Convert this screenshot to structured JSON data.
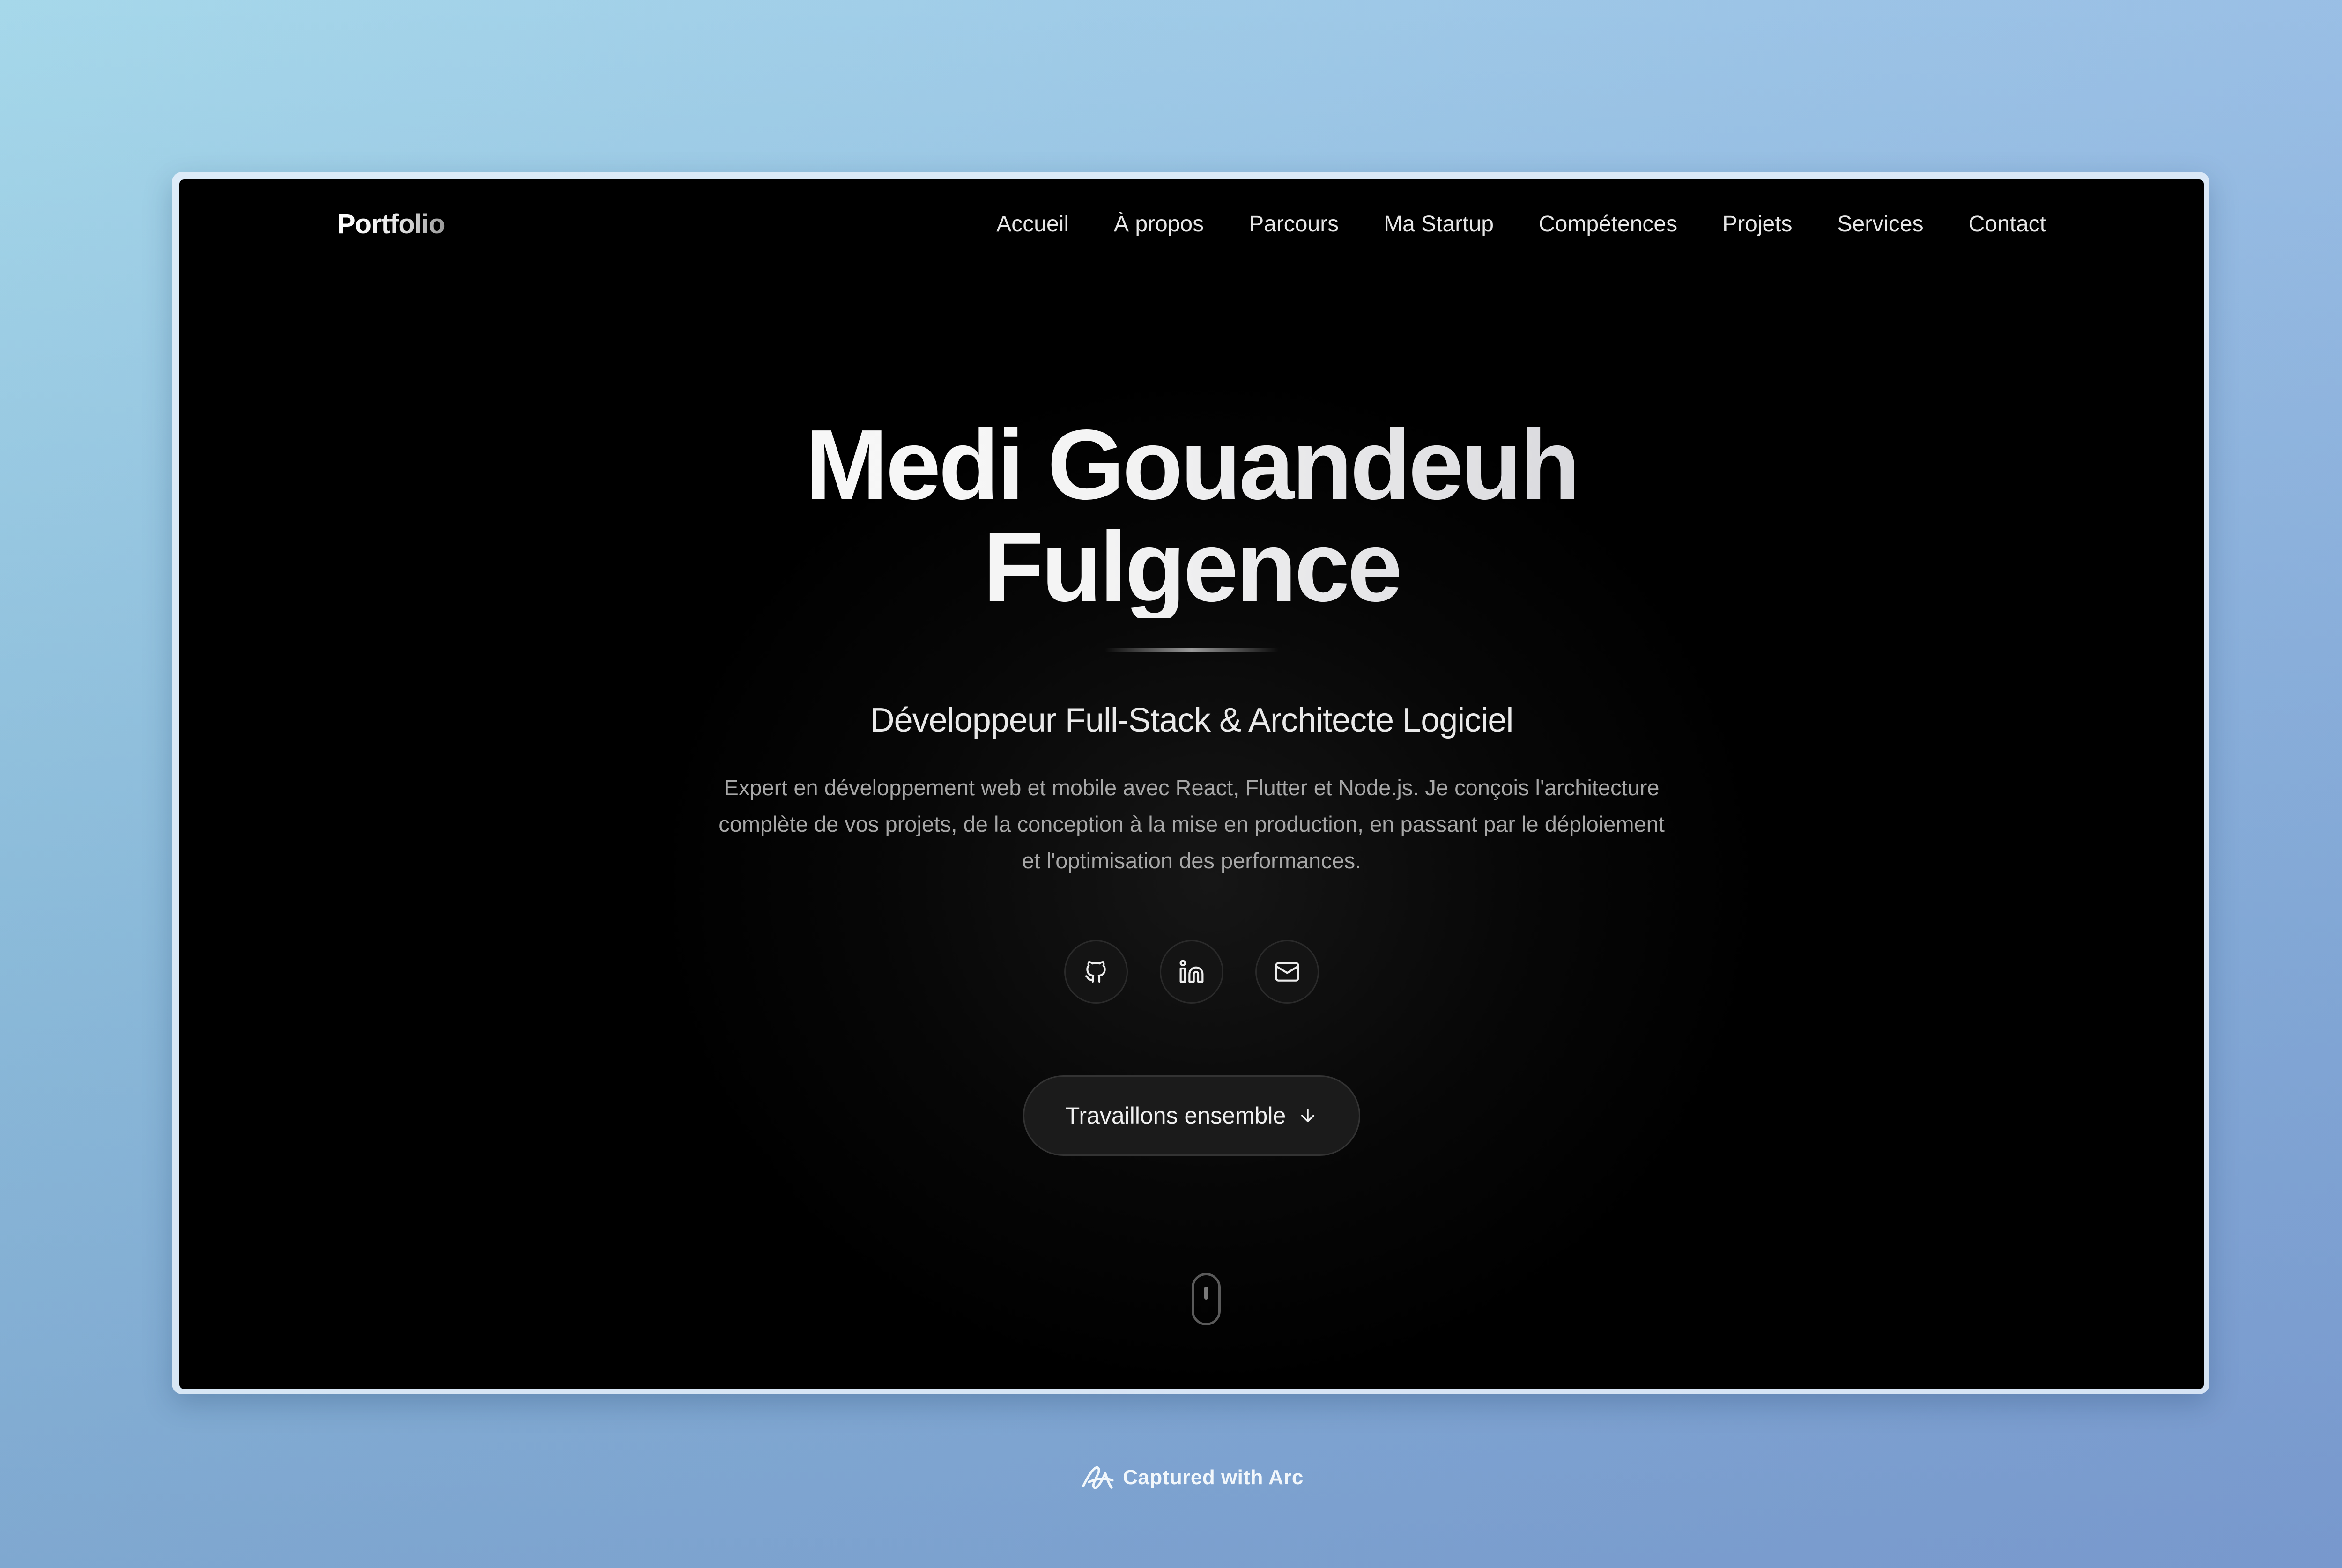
{
  "nav": {
    "brand": "Portfolio",
    "links": [
      {
        "label": "Accueil"
      },
      {
        "label": "À propos"
      },
      {
        "label": "Parcours"
      },
      {
        "label": "Ma Startup"
      },
      {
        "label": "Compétences"
      },
      {
        "label": "Projets"
      },
      {
        "label": "Services"
      },
      {
        "label": "Contact"
      }
    ]
  },
  "hero": {
    "title_line1": "Medi Gouandeuh",
    "title_line2": "Fulgence",
    "subtitle": "Développeur Full-Stack & Architecte Logiciel",
    "description": "Expert en développement web et mobile avec React, Flutter et Node.js. Je conçois l'architecture complète de vos projets, de la conception à la mise en production, en passant par le déploiement et l'optimisation des performances.",
    "social": [
      {
        "icon": "github-icon"
      },
      {
        "icon": "linkedin-icon"
      },
      {
        "icon": "mail-icon"
      }
    ],
    "cta_label": "Travaillons ensemble",
    "cta_icon": "arrow-down-icon"
  },
  "scroll": {
    "icon": "mouse-scroll-icon"
  },
  "caption": {
    "text": "Captured with Arc",
    "icon": "arc-logo-icon"
  },
  "colors": {
    "page_background": "#000000",
    "text_primary": "#e6e6e6",
    "text_muted": "#a7a7a7",
    "button_background": "#1b1b1b"
  }
}
